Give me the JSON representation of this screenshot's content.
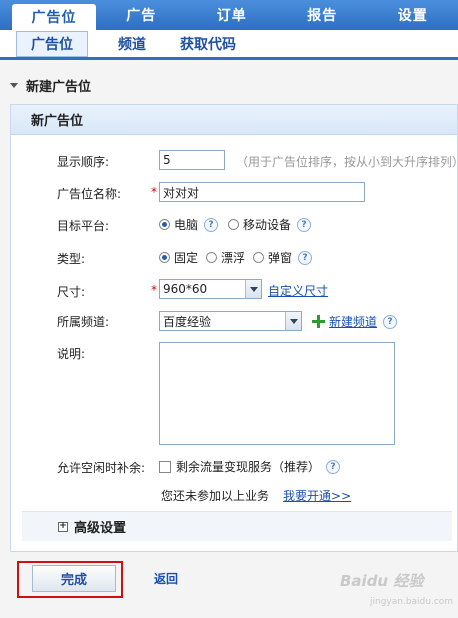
{
  "topnav": {
    "tabs": [
      {
        "label": "广告位"
      },
      {
        "label": "广告"
      },
      {
        "label": "订单"
      },
      {
        "label": "报告"
      },
      {
        "label": "设置"
      }
    ]
  },
  "subnav": {
    "tabs": [
      {
        "label": "广告位"
      },
      {
        "label": "频道"
      },
      {
        "label": "获取代码"
      }
    ]
  },
  "section": {
    "title": "新建广告位"
  },
  "panel": {
    "title": "新广告位"
  },
  "form": {
    "order_label": "显示顺序:",
    "order_value": "5",
    "order_hint": "（用于广告位排序，按从小到大升序排列）",
    "name_label": "广告位名称:",
    "name_required": "*",
    "name_value": "对对对",
    "platform_label": "目标平台:",
    "platform_options": [
      "电脑",
      "移动设备"
    ],
    "type_label": "类型:",
    "type_options": [
      "固定",
      "漂浮",
      "弹窗"
    ],
    "size_label": "尺寸:",
    "size_required": "*",
    "size_value": "960*60",
    "size_custom_link": "自定义尺寸",
    "channel_label": "所属频道:",
    "channel_value": "百度经验",
    "new_channel_link": "新建频道",
    "desc_label": "说明:",
    "fill_label": "允许空闲时补余:",
    "fill_checkbox_label": "剩余流量变现服务（推荐）",
    "fill_notice": "您还未参加以上业务",
    "fill_link": "我要开通>>",
    "help_glyph": "?"
  },
  "advanced": {
    "label": "高级设置",
    "toggle_glyph": "+"
  },
  "actions": {
    "done_label": "完成",
    "back_label": "返回"
  },
  "watermark": {
    "text": "Baidu 经验",
    "sub": "jingyan.baidu.com"
  },
  "colors": {
    "accent": "#2f6fc0",
    "highlight_box": "#d01010"
  }
}
